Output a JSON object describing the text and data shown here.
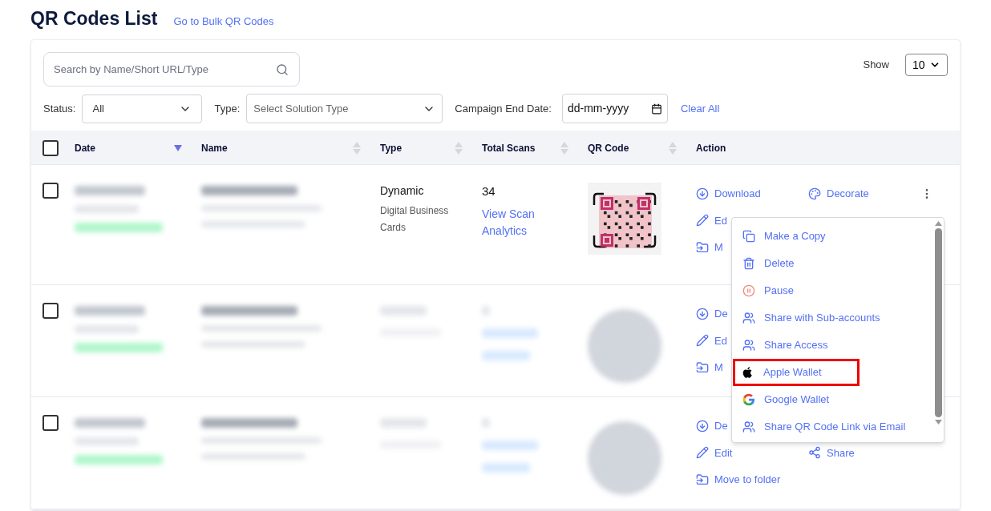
{
  "page": {
    "title": "QR Codes List",
    "bulk_link": "Go to Bulk QR Codes"
  },
  "search": {
    "placeholder": "Search by Name/Short URL/Type"
  },
  "show": {
    "label": "Show",
    "value": "10"
  },
  "filters": {
    "status_label": "Status:",
    "status_value": "All",
    "type_label": "Type:",
    "type_placeholder": "Select Solution Type",
    "date_label": "Campaign End Date:",
    "date_placeholder": "dd-mm-yyyy",
    "clear": "Clear All"
  },
  "table": {
    "select_all_checked": false,
    "columns": [
      {
        "label": "Date",
        "sortable": true,
        "sorted": true
      },
      {
        "label": "Name",
        "sortable": true,
        "sorted": false
      },
      {
        "label": "Type",
        "sortable": true,
        "sorted": false
      },
      {
        "label": "Total Scans",
        "sortable": true,
        "sorted": false
      },
      {
        "label": "QR Code",
        "sortable": true,
        "sorted": false
      },
      {
        "label": "Action",
        "sortable": false
      }
    ],
    "rows": [
      {
        "checked": false,
        "blurred": false,
        "type": "Dynamic",
        "subtype": "Digital Business Cards",
        "scans": "34",
        "analytics": "View Scan Analytics",
        "action_lines": [
          [
            {
              "kind": "download",
              "label": "Download"
            },
            {
              "kind": "decorate",
              "label": "Decorate"
            },
            {
              "kind": "more"
            }
          ],
          [
            {
              "kind": "edit",
              "label": "Ed"
            }
          ],
          [
            {
              "kind": "move",
              "label": "M"
            }
          ]
        ]
      },
      {
        "checked": false,
        "blurred": true,
        "action_lines": [
          [
            {
              "kind": "download",
              "label": "De"
            }
          ],
          [
            {
              "kind": "edit",
              "label": "Ed"
            }
          ],
          [
            {
              "kind": "move",
              "label": "M"
            }
          ]
        ]
      },
      {
        "checked": false,
        "blurred": true,
        "action_lines": [
          [
            {
              "kind": "download",
              "label": "De"
            }
          ],
          [
            {
              "kind": "edit",
              "label": "Edit"
            },
            {
              "kind": "share",
              "label": "Share"
            }
          ],
          [
            {
              "kind": "move",
              "label": "Move to folder"
            }
          ]
        ]
      }
    ]
  },
  "menu": {
    "items": [
      {
        "kind": "copy",
        "label": "Make a Copy",
        "highlighted": false
      },
      {
        "kind": "delete",
        "label": "Delete",
        "highlighted": false
      },
      {
        "kind": "pause",
        "label": "Pause",
        "highlighted": false
      },
      {
        "kind": "users",
        "label": "Share with Sub-accounts",
        "highlighted": false
      },
      {
        "kind": "users",
        "label": "Share Access",
        "highlighted": false
      },
      {
        "kind": "apple",
        "label": "Apple Wallet",
        "highlighted": true
      },
      {
        "kind": "google",
        "label": "Google Wallet",
        "highlighted": false
      },
      {
        "kind": "users",
        "label": "Share QR Code Link via Email",
        "highlighted": false
      }
    ]
  }
}
